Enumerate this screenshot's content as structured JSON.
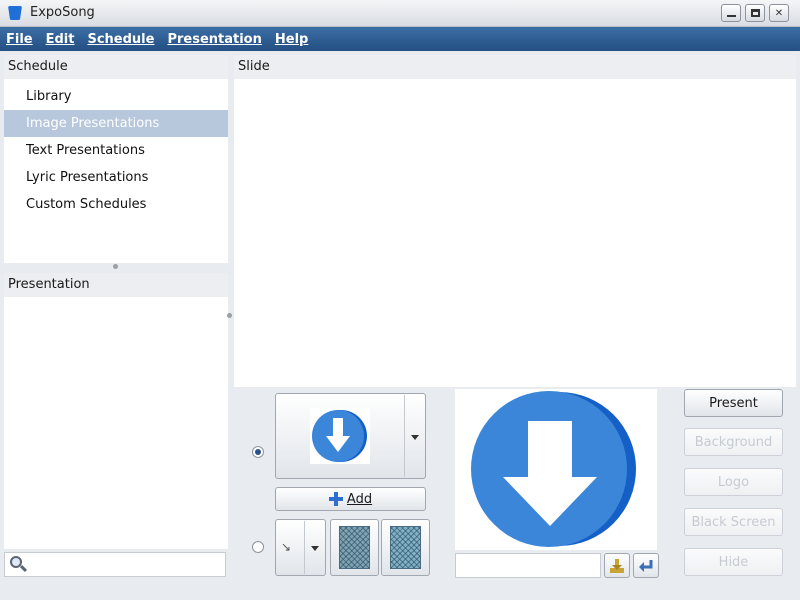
{
  "window": {
    "title": "ExpoSong"
  },
  "menubar": {
    "items": [
      "File",
      "Edit",
      "Schedule",
      "Presentation",
      "Help"
    ]
  },
  "schedule": {
    "header": "Schedule",
    "items": [
      {
        "label": "Library",
        "selected": false
      },
      {
        "label": "Image Presentations",
        "selected": true
      },
      {
        "label": "Text Presentations",
        "selected": false
      },
      {
        "label": "Lyric Presentations",
        "selected": false
      },
      {
        "label": "Custom Schedules",
        "selected": false
      }
    ]
  },
  "presentation": {
    "header": "Presentation"
  },
  "slide": {
    "header": "Slide"
  },
  "background_controls": {
    "image_radio_checked": true,
    "pattern_radio_checked": false,
    "add_label": "Add"
  },
  "right_buttons": {
    "present": "Present",
    "background": "Background",
    "logo": "Logo",
    "black_screen": "Black Screen",
    "hide": "Hide"
  },
  "colors": {
    "menubar": "#2f5f94",
    "selection": "#b7c7dc",
    "arrow_icon_blue": "#3b86d8"
  },
  "icons": [
    "app-icon",
    "search-icon",
    "download-arrow-icon",
    "plus-icon",
    "import-icon",
    "enter-icon"
  ]
}
